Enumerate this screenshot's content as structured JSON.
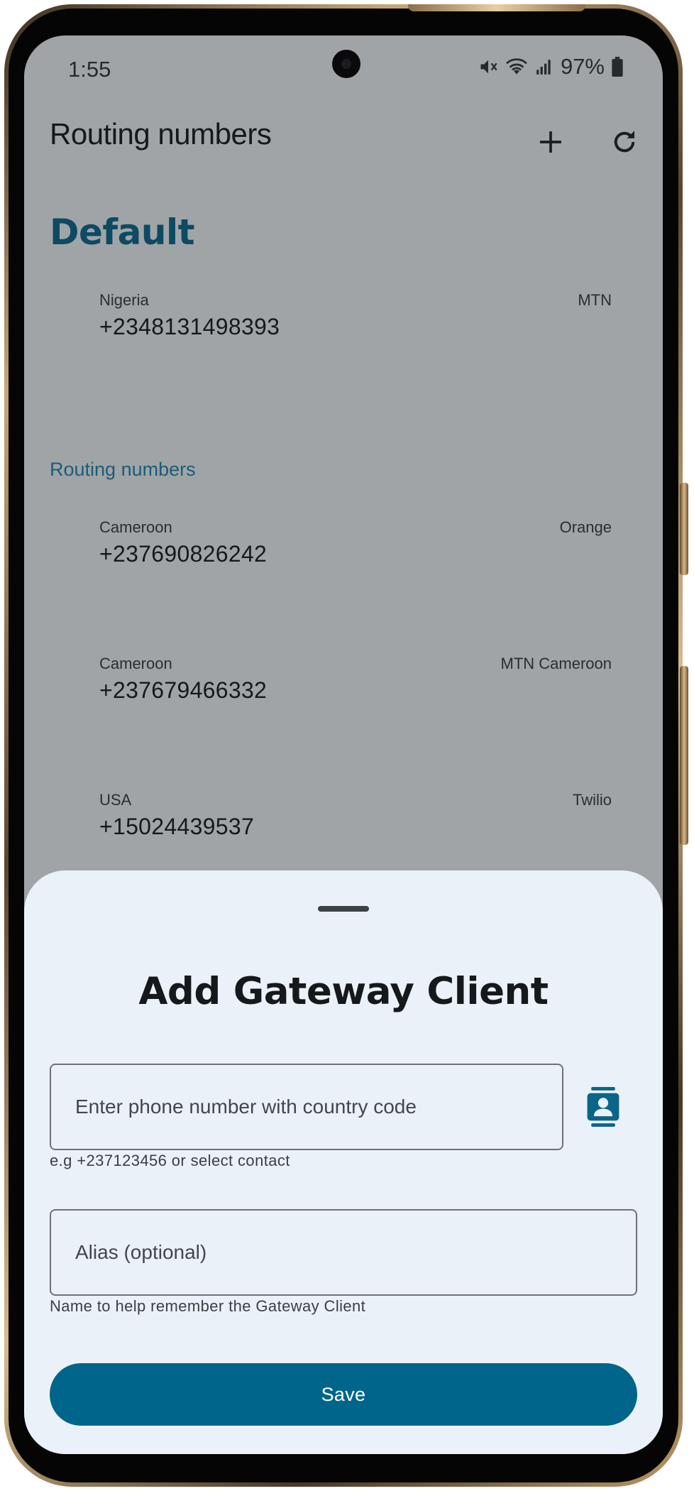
{
  "status_bar": {
    "time": "1:55",
    "battery": "97%",
    "icons": [
      "mute-icon",
      "wifi-icon",
      "signal-icon",
      "battery-icon"
    ]
  },
  "app_bar": {
    "title": "Routing numbers",
    "actions": [
      "add-icon",
      "refresh-icon"
    ]
  },
  "default_section": {
    "heading": "Default",
    "item": {
      "country": "Nigeria",
      "carrier": "MTN",
      "phone": "+2348131498393"
    }
  },
  "routing_section": {
    "heading": "Routing numbers",
    "items": [
      {
        "country": "Cameroon",
        "carrier": "Orange",
        "phone": "+237690826242"
      },
      {
        "country": "Cameroon",
        "carrier": "MTN Cameroon",
        "phone": "+237679466332"
      },
      {
        "country": "USA",
        "carrier": "Twilio",
        "phone": "+15024439537"
      }
    ]
  },
  "sheet": {
    "title": "Add Gateway Client",
    "phone_field": {
      "placeholder": "Enter phone number with country code",
      "value": "",
      "helper": "e.g +237123456 or select contact"
    },
    "alias_field": {
      "placeholder": "Alias (optional)",
      "value": "",
      "helper": "Name to help remember the Gateway Client"
    },
    "save_label": "Save",
    "contact_icon": "contact-book-icon"
  },
  "colors": {
    "primary": "#00658a",
    "scrim_bg": "#a1a4a6",
    "sheet_bg": "#ebf1f8",
    "heading_accent": "#0d4a64"
  }
}
